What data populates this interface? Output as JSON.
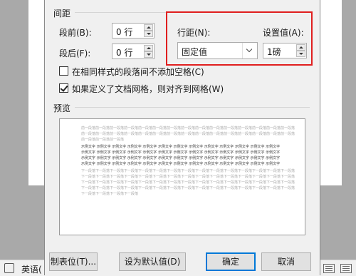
{
  "spacing": {
    "section_label": "间距",
    "before_label": "段前(B):",
    "before_value": "0 行",
    "after_label": "段后(F):",
    "after_value": "0 行",
    "line_spacing_label": "行距(N):",
    "line_spacing_value": "固定值",
    "set_value_label": "设置值(A):",
    "set_value": "1磅",
    "no_space_same_style": "在相同样式的段落间不添加空格(C)",
    "snap_to_grid": "如果定义了文档网格，则对齐到网格(W)",
    "no_space_checked": false,
    "snap_checked": true
  },
  "preview": {
    "section_label": "预览",
    "prev_line_a": "前一段落前一段落前一段落前一段落前一段落前一段落前一段落前一段落前一段落前一段落前一段落前一段落前一段落前一段落前一段落",
    "prev_line_b": "前一段落前一段落前一段落",
    "sample_line": "示例文字 示例文字 示例文字 示例文字 示例文字 示例文字 示例文字 示例文字 示例文字 示例文字 示例文字 示例文字 示例文字",
    "sample_line_end": "示例文字 示例文字 示例文字 示例文字 示例文字",
    "next_line_a": "下一段落下一段落下一段落下一段落下一段落下一段落下一段落下一段落下一段落下一段落下一段落下一段落下一段落下一段落下一段落",
    "next_line_b": "下一段落下一段落下一段落下一段落"
  },
  "buttons": {
    "tabs": "制表位(T)...",
    "set_default": "设为默认值(D)",
    "ok": "确定",
    "cancel": "取消"
  },
  "statusbar": {
    "language": "英语("
  },
  "colors": {
    "highlight": "#e01f1f",
    "ok_border": "#0078d7"
  }
}
